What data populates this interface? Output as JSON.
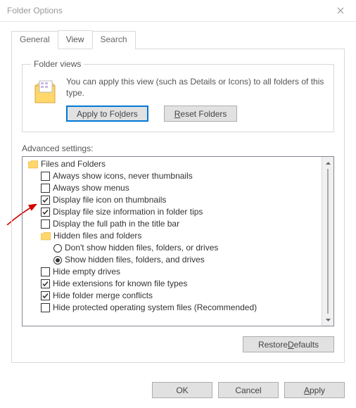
{
  "title": "Folder Options",
  "tabs": {
    "general": "General",
    "view": "View",
    "search": "Search"
  },
  "folderviews": {
    "legend": "Folder views",
    "text": "You can apply this view (such as Details or Icons) to all folders of this type.",
    "apply_pre": "Apply to Fo",
    "apply_u": "l",
    "apply_post": "ders",
    "reset_u": "R",
    "reset_post": "eset Folders"
  },
  "advanced": {
    "label": "Advanced settings:",
    "root": "Files and Folders",
    "items": [
      {
        "type": "check",
        "checked": false,
        "label": "Always show icons, never thumbnails"
      },
      {
        "type": "check",
        "checked": false,
        "label": "Always show menus"
      },
      {
        "type": "check",
        "checked": true,
        "label": "Display file icon on thumbnails"
      },
      {
        "type": "check",
        "checked": true,
        "label": "Display file size information in folder tips"
      },
      {
        "type": "check",
        "checked": false,
        "label": "Display the full path in the title bar"
      },
      {
        "type": "folder",
        "label": "Hidden files and folders"
      },
      {
        "type": "radio",
        "selected": false,
        "label": "Don't show hidden files, folders, or drives"
      },
      {
        "type": "radio",
        "selected": true,
        "label": "Show hidden files, folders, and drives"
      },
      {
        "type": "check",
        "checked": false,
        "label": "Hide empty drives"
      },
      {
        "type": "check",
        "checked": true,
        "label": "Hide extensions for known file types"
      },
      {
        "type": "check",
        "checked": true,
        "label": "Hide folder merge conflicts"
      },
      {
        "type": "check",
        "checked": false,
        "label": "Hide protected operating system files (Recommended)"
      }
    ],
    "restore_pre": "Restore ",
    "restore_u": "D",
    "restore_post": "efaults"
  },
  "buttons": {
    "ok": "OK",
    "cancel": "Cancel",
    "apply_u": "A",
    "apply_post": "pply"
  }
}
